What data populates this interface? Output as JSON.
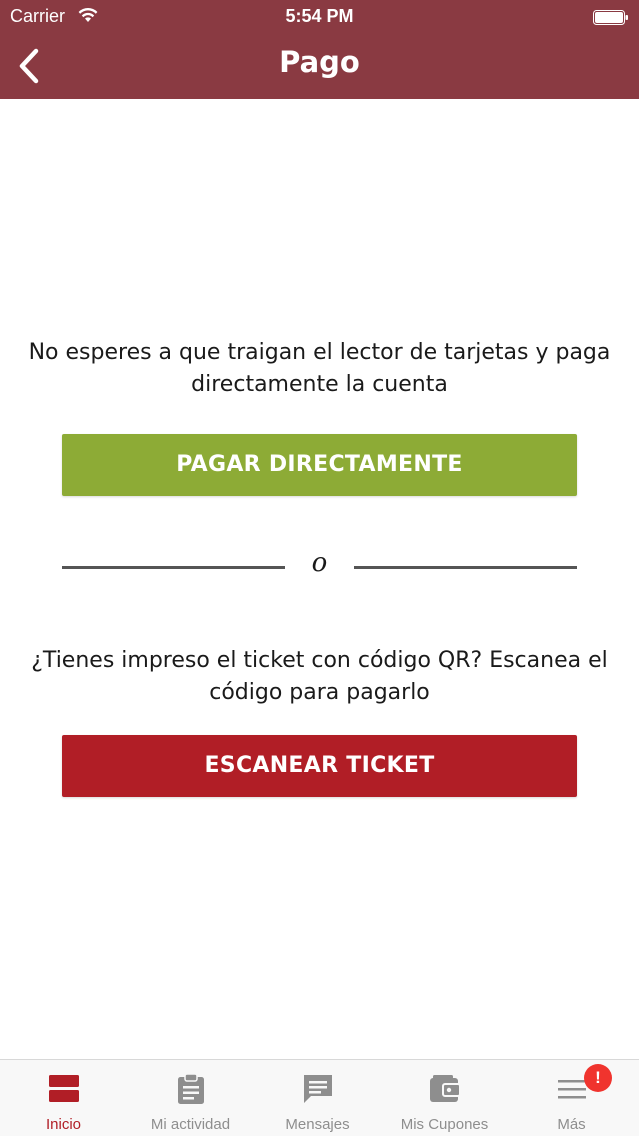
{
  "status_bar": {
    "carrier": "Carrier",
    "time": "5:54 PM"
  },
  "header": {
    "title": "Pago",
    "back_icon": "chevron-left-icon",
    "background_color": "#8a3a42"
  },
  "main": {
    "pay_prompt": "No esperes a que traigan el lector de tarjetas y paga directamente la cuenta",
    "pay_button_label": "PAGAR DIRECTAMENTE",
    "pay_button_color": "#8dab36",
    "divider_text": "o",
    "scan_prompt": "¿Tienes impreso el ticket con código QR? Escanea el código para pagarlo",
    "scan_button_label": "ESCANEAR TICKET",
    "scan_button_color": "#b11e26"
  },
  "tab_bar": {
    "tabs": [
      {
        "label": "Inicio",
        "icon": "home-icon",
        "active": true
      },
      {
        "label": "Mi actividad",
        "icon": "clipboard-icon",
        "active": false
      },
      {
        "label": "Mensajes",
        "icon": "message-icon",
        "active": false
      },
      {
        "label": "Mis Cupones",
        "icon": "wallet-icon",
        "active": false
      },
      {
        "label": "Más",
        "icon": "menu-icon",
        "active": false
      }
    ],
    "badge": "!",
    "active_color": "#b11e26"
  }
}
